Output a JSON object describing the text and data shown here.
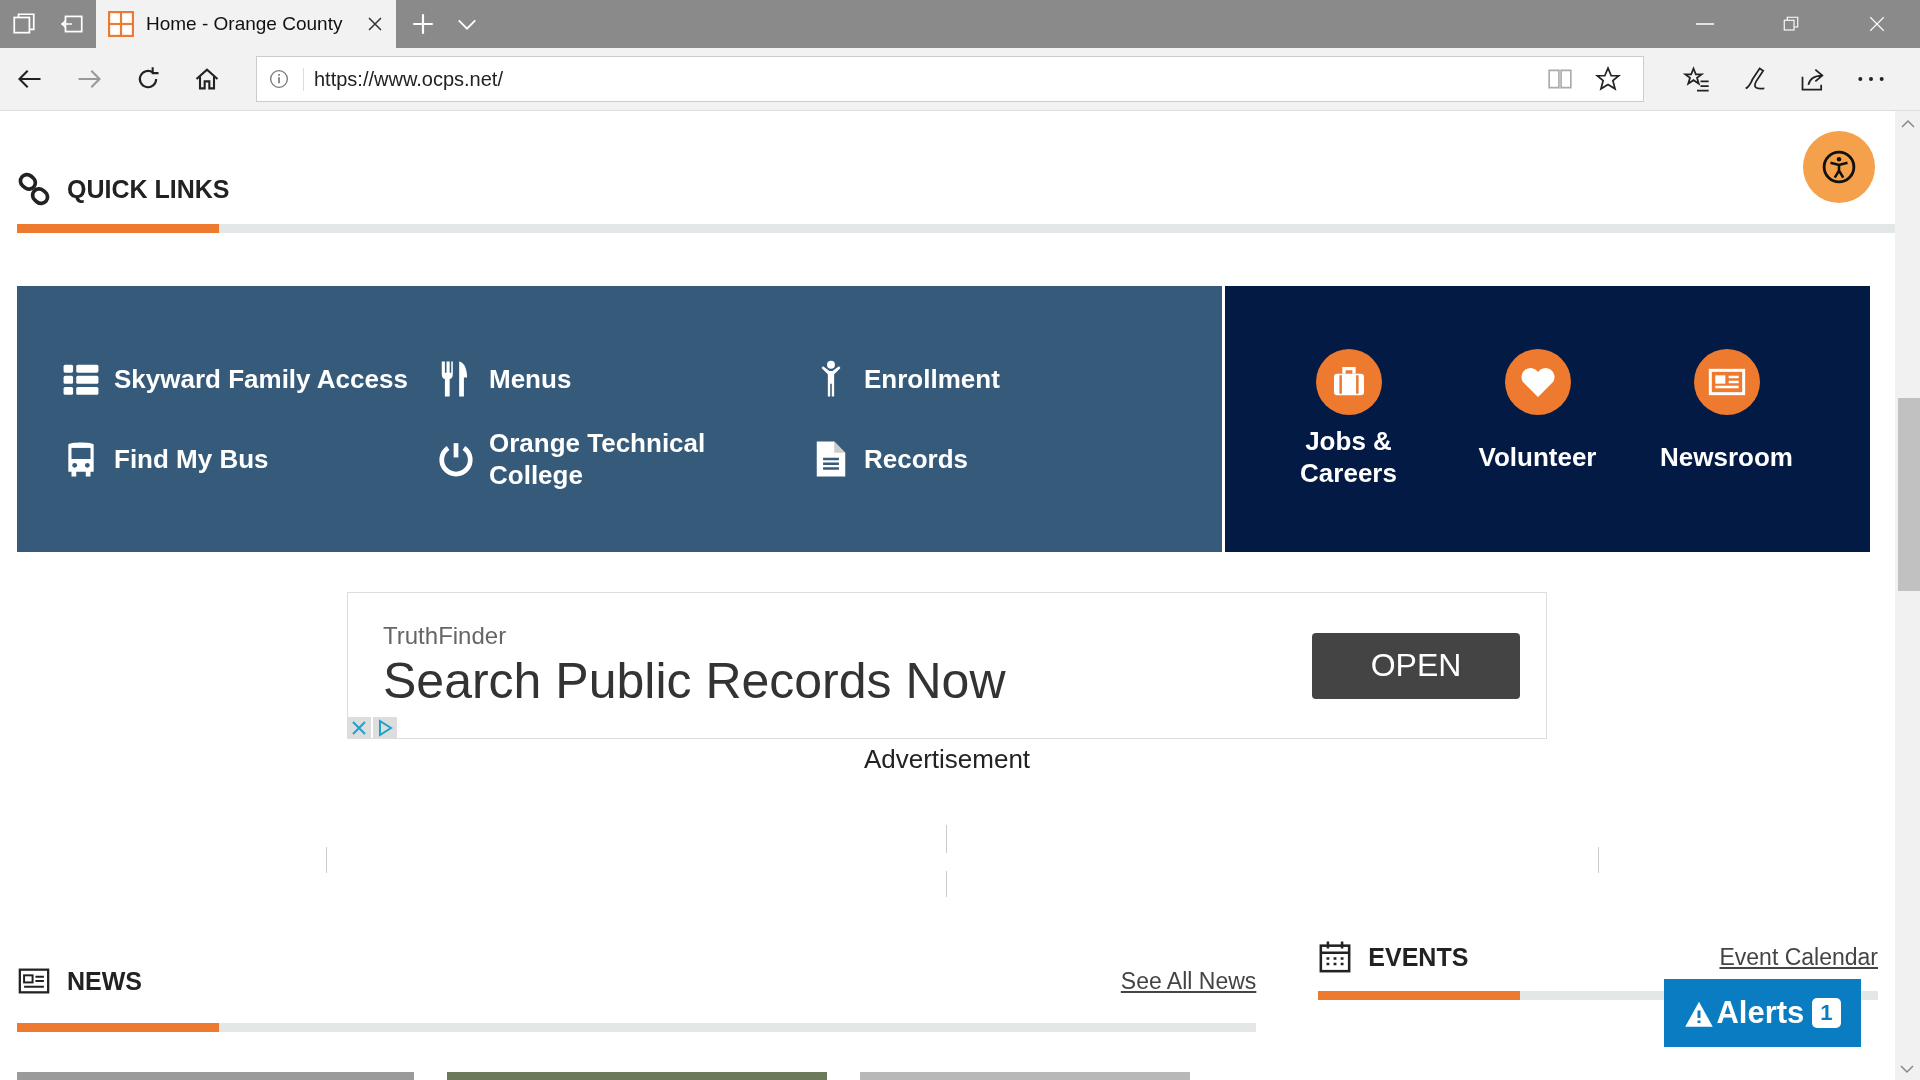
{
  "browser": {
    "tab": {
      "title": "Home - Orange County",
      "selected": true
    },
    "url": "https://www.ocps.net/"
  },
  "quick_links": {
    "title": "QUICK LINKS",
    "items": [
      {
        "label": "Skyward Family Access"
      },
      {
        "label": "Menus"
      },
      {
        "label": "Enrollment"
      },
      {
        "label": "Find My Bus"
      },
      {
        "label": "Orange Technical College"
      },
      {
        "label": "Records"
      }
    ],
    "featured": [
      {
        "label": "Jobs & Careers"
      },
      {
        "label": "Volunteer"
      },
      {
        "label": "Newsroom"
      }
    ]
  },
  "ad": {
    "brand": "TruthFinder",
    "headline": "Search Public Records Now",
    "button": "OPEN",
    "caption": "Advertisement"
  },
  "news": {
    "title": "NEWS",
    "link": "See All News"
  },
  "events": {
    "title": "EVENTS",
    "link": "Event Calendar"
  },
  "alerts": {
    "label": "Alerts",
    "count": "1"
  }
}
